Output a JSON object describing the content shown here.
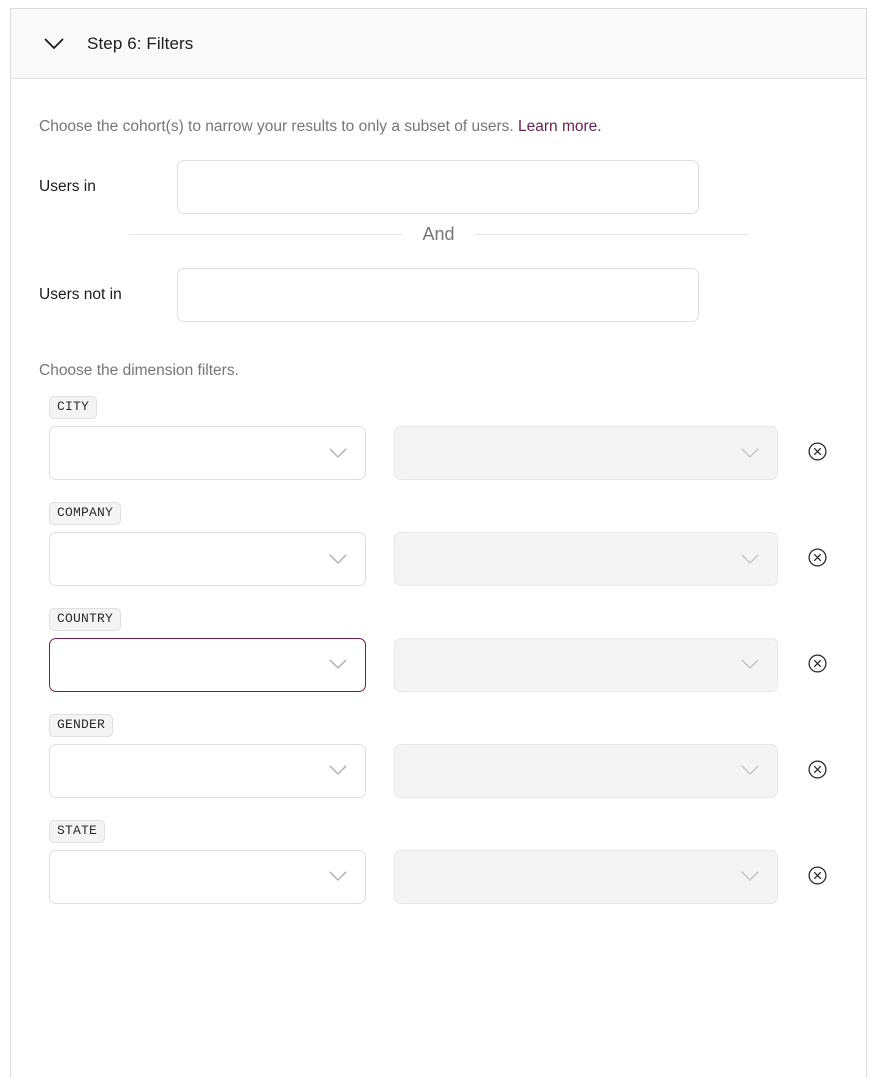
{
  "header": {
    "title": "Step 6: Filters",
    "chevron_icon": "chevron-down-icon",
    "expanded": true
  },
  "cohorts": {
    "description_prefix": "Choose the cohort(s) to narrow your results to only a subset of users. ",
    "learn_more_label": "Learn more.",
    "link_color": "#6c2251",
    "users_in": {
      "label": "Users in",
      "value": "",
      "placeholder": ""
    },
    "conjunction": "And",
    "users_not_in": {
      "label": "Users not in",
      "value": "",
      "placeholder": ""
    }
  },
  "dimensions": {
    "heading": "Choose the dimension filters.",
    "remove_icon": "circle-x-icon",
    "chevron_icon": "chevron-down-icon",
    "focus_border_color": "#6c2251",
    "rows": [
      {
        "badge": "CITY",
        "operator_value": "",
        "value_value": "",
        "value_disabled": true,
        "focused": false
      },
      {
        "badge": "COMPANY",
        "operator_value": "",
        "value_value": "",
        "value_disabled": true,
        "focused": false
      },
      {
        "badge": "COUNTRY",
        "operator_value": "",
        "value_value": "",
        "value_disabled": true,
        "focused": true
      },
      {
        "badge": "GENDER",
        "operator_value": "",
        "value_value": "",
        "value_disabled": true,
        "focused": false
      },
      {
        "badge": "STATE",
        "operator_value": "",
        "value_value": "",
        "value_disabled": true,
        "focused": false
      }
    ]
  }
}
